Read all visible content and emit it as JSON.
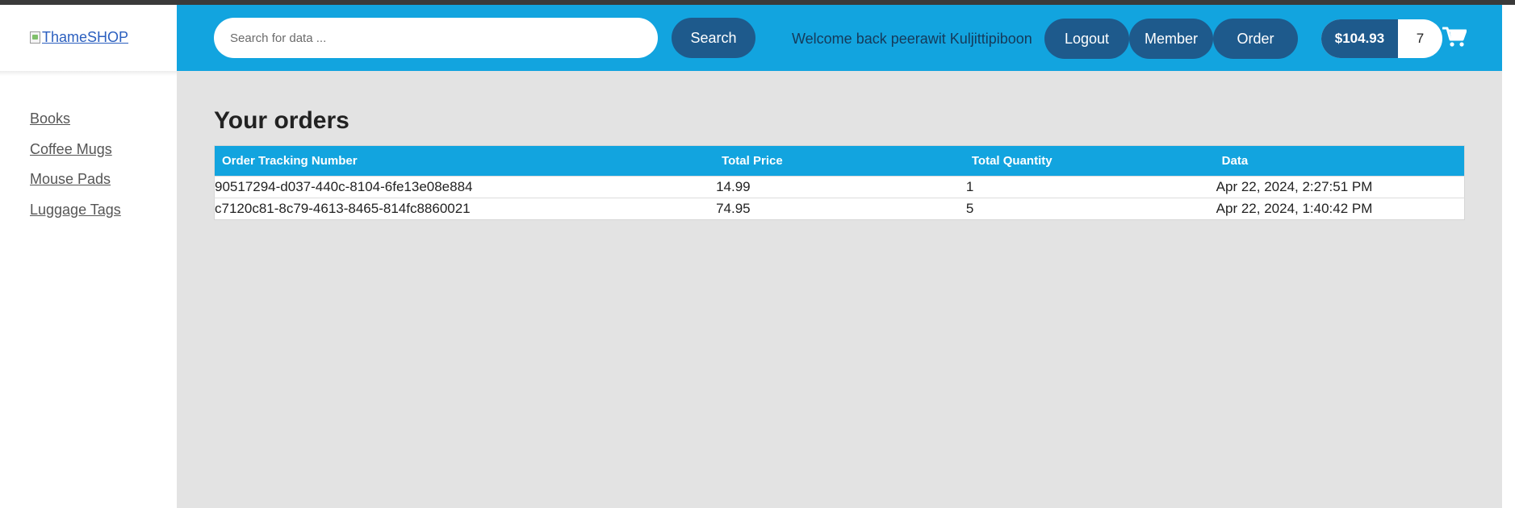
{
  "brand": {
    "logo_alt": "ThameSHOP"
  },
  "sidebar": {
    "items": [
      {
        "label": "Books"
      },
      {
        "label": "Coffee Mugs"
      },
      {
        "label": "Mouse Pads"
      },
      {
        "label": "Luggage Tags"
      }
    ]
  },
  "header": {
    "search_placeholder": "Search for data ...",
    "search_label": "Search",
    "welcome": "Welcome back peerawit Kuljittipiboon",
    "logout_label": "Logout",
    "member_label": "Member",
    "order_label": "Order",
    "cart_amount": "$104.93",
    "cart_count": "7",
    "cart_icon": "shopping-cart-icon"
  },
  "main": {
    "title": "Your orders",
    "columns": [
      "Order Tracking Number",
      "Total Price",
      "Total Quantity",
      "Data"
    ],
    "rows": [
      {
        "tracking": "90517294-d037-440c-8104-6fe13e08e884",
        "price": "14.99",
        "qty": "1",
        "date": "Apr 22, 2024, 2:27:51 PM"
      },
      {
        "tracking": "c7120c81-8c79-4613-8465-814fc8860021",
        "price": "74.95",
        "qty": "5",
        "date": "Apr 22, 2024, 1:40:42 PM"
      }
    ]
  },
  "colors": {
    "header_bg": "#12a4df",
    "button_bg": "#1e5a8c",
    "page_bg": "#e3e3e3"
  }
}
